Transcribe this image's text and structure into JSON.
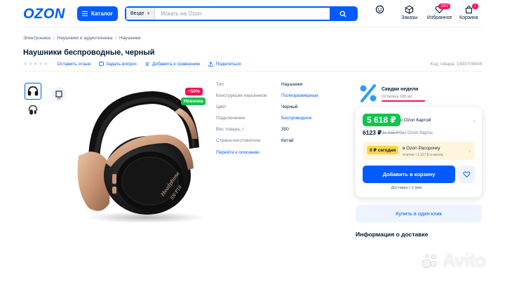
{
  "header": {
    "logo": "OZON",
    "catalog_label": "Каталог",
    "search": {
      "scope": "Везде",
      "placeholder": "Искать на Ozon"
    },
    "actions": [
      {
        "name": "profile",
        "label": "",
        "icon": "smile-icon"
      },
      {
        "name": "orders",
        "label": "Заказы",
        "icon": "box-icon"
      },
      {
        "name": "favorites",
        "label": "Избранное",
        "icon": "heart-icon",
        "badge": "1063"
      },
      {
        "name": "cart",
        "label": "Корзина",
        "icon": "bag-icon",
        "badge": "1"
      }
    ]
  },
  "breadcrumbs": [
    "Электроника",
    "Наушники и аудиотехника",
    "Наушники"
  ],
  "product": {
    "title": "Наушники беспроводные, черный",
    "actions": {
      "reviews": "Оставить отзыв",
      "question": "Задать вопрос",
      "compare": "Добавить к сравнению",
      "share": "Поделиться"
    },
    "sku": "Код товара: 1493709608",
    "image_text": "Headphone\nSN-P16",
    "badges": {
      "sale": "−50%",
      "new": "Новинка"
    }
  },
  "specs": {
    "rows": [
      {
        "label": "Тип",
        "value": "Наушники",
        "link": false
      },
      {
        "label": "Конструкция наушников",
        "value": "Полноразмерные",
        "link": true
      },
      {
        "label": "Цвет",
        "value": "Черный",
        "link": false
      },
      {
        "label": "Подключение",
        "value": "Беспроводное",
        "link": true
      },
      {
        "label": "Вес товара, г",
        "value": "350",
        "link": false
      },
      {
        "label": "Страна-изготовитель",
        "value": "Китай",
        "link": false
      }
    ],
    "more_link": "Перейти к описанию"
  },
  "promo": {
    "title": "Скидки недели",
    "subtitle": "Осталось 100 шт"
  },
  "price": {
    "card_price": "5 618 ₽",
    "card_label": "с Ozon Картой",
    "regular_price": "6123 ₽",
    "old_price": "11 325 ₽",
    "regular_label": "без Ozon Карты",
    "installment_chip": "0 ₽ сегодня",
    "installment_label": "в Ozon Рассрочку",
    "installment_sub": "платеж ≈1 127 ₽ в месяц",
    "add_to_cart": "Добавить в корзину",
    "delivery_note": "Доставка с 1 мая",
    "one_click": "Купить в один клик"
  },
  "delivery_title": "Информация о доставке",
  "watermark": "Avito",
  "colors": {
    "brand": "#005bff",
    "sale": "#f91155",
    "price_green": "#10c44c",
    "installment_bg": "#fff5dc"
  }
}
